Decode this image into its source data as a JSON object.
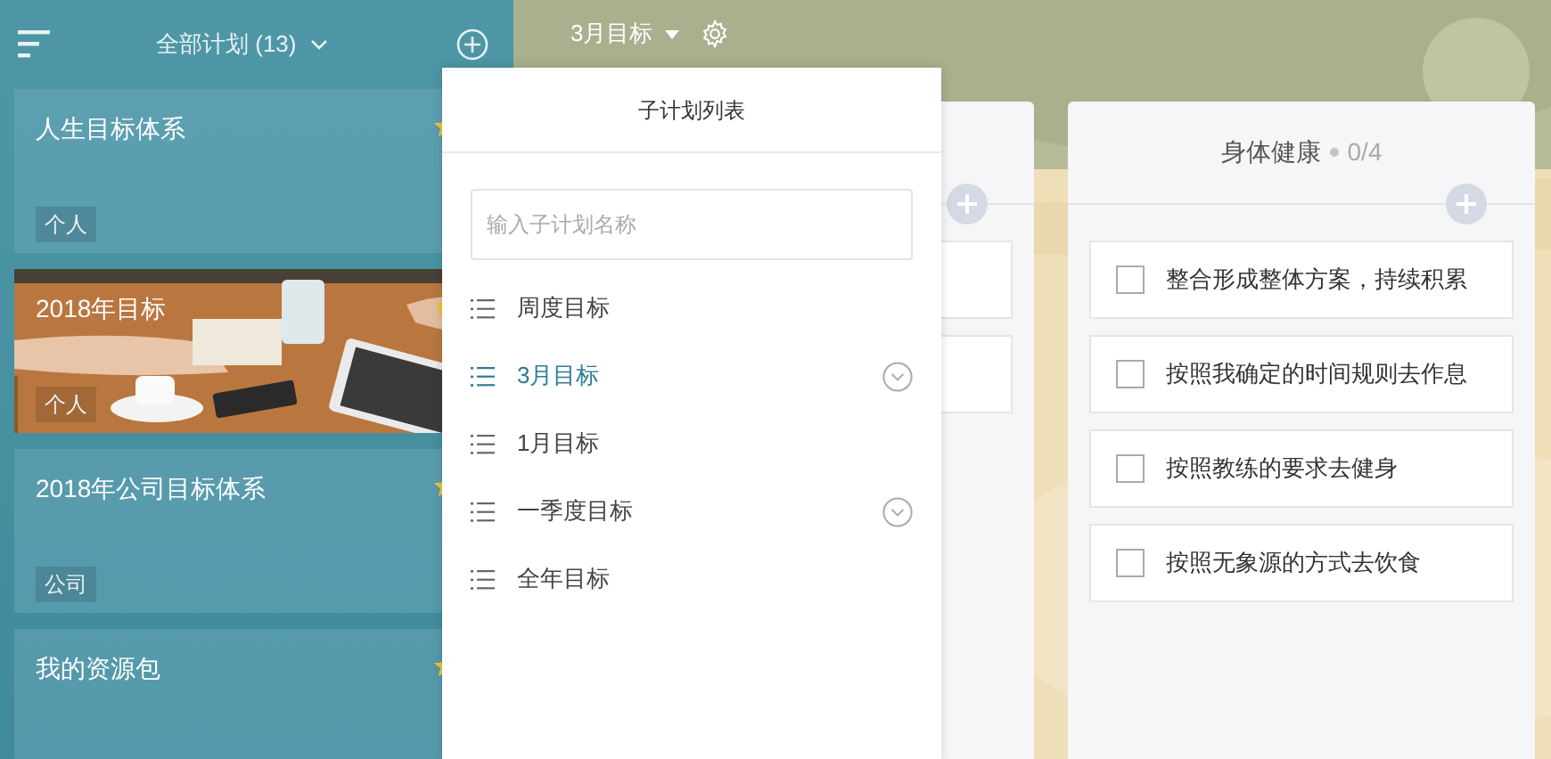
{
  "sidebar": {
    "title": "全部计划 (13)",
    "plans": [
      {
        "title": "人生目标体系",
        "tag": "个人",
        "kind": "plain"
      },
      {
        "title": "2018年目标",
        "tag": "个人",
        "kind": "picture"
      },
      {
        "title": "2018年公司目标体系",
        "tag": "公司",
        "kind": "plain"
      },
      {
        "title": "我的资源包",
        "kind": "plain"
      }
    ]
  },
  "board": {
    "plan_title": "3月目标",
    "columns": [
      {
        "title": "身体健康",
        "count": "0/4",
        "tasks": [
          {
            "text": "整合形成整体方案，持续积累",
            "checked": false
          },
          {
            "text": "按照我确定的时间规则去作息",
            "checked": false
          },
          {
            "text": "按照教练的要求去健身",
            "checked": false
          },
          {
            "text": "按照无象源的方式去饮食",
            "checked": false
          }
        ]
      }
    ]
  },
  "dropdown": {
    "title": "子计划列表",
    "placeholder": "输入子计划名称",
    "items": [
      {
        "label": "周度目标",
        "selected": false,
        "expandable": false
      },
      {
        "label": "3月目标",
        "selected": true,
        "expandable": true
      },
      {
        "label": "1月目标",
        "selected": false,
        "expandable": false
      },
      {
        "label": "一季度目标",
        "selected": false,
        "expandable": true
      },
      {
        "label": "全年目标",
        "selected": false,
        "expandable": false
      }
    ]
  }
}
